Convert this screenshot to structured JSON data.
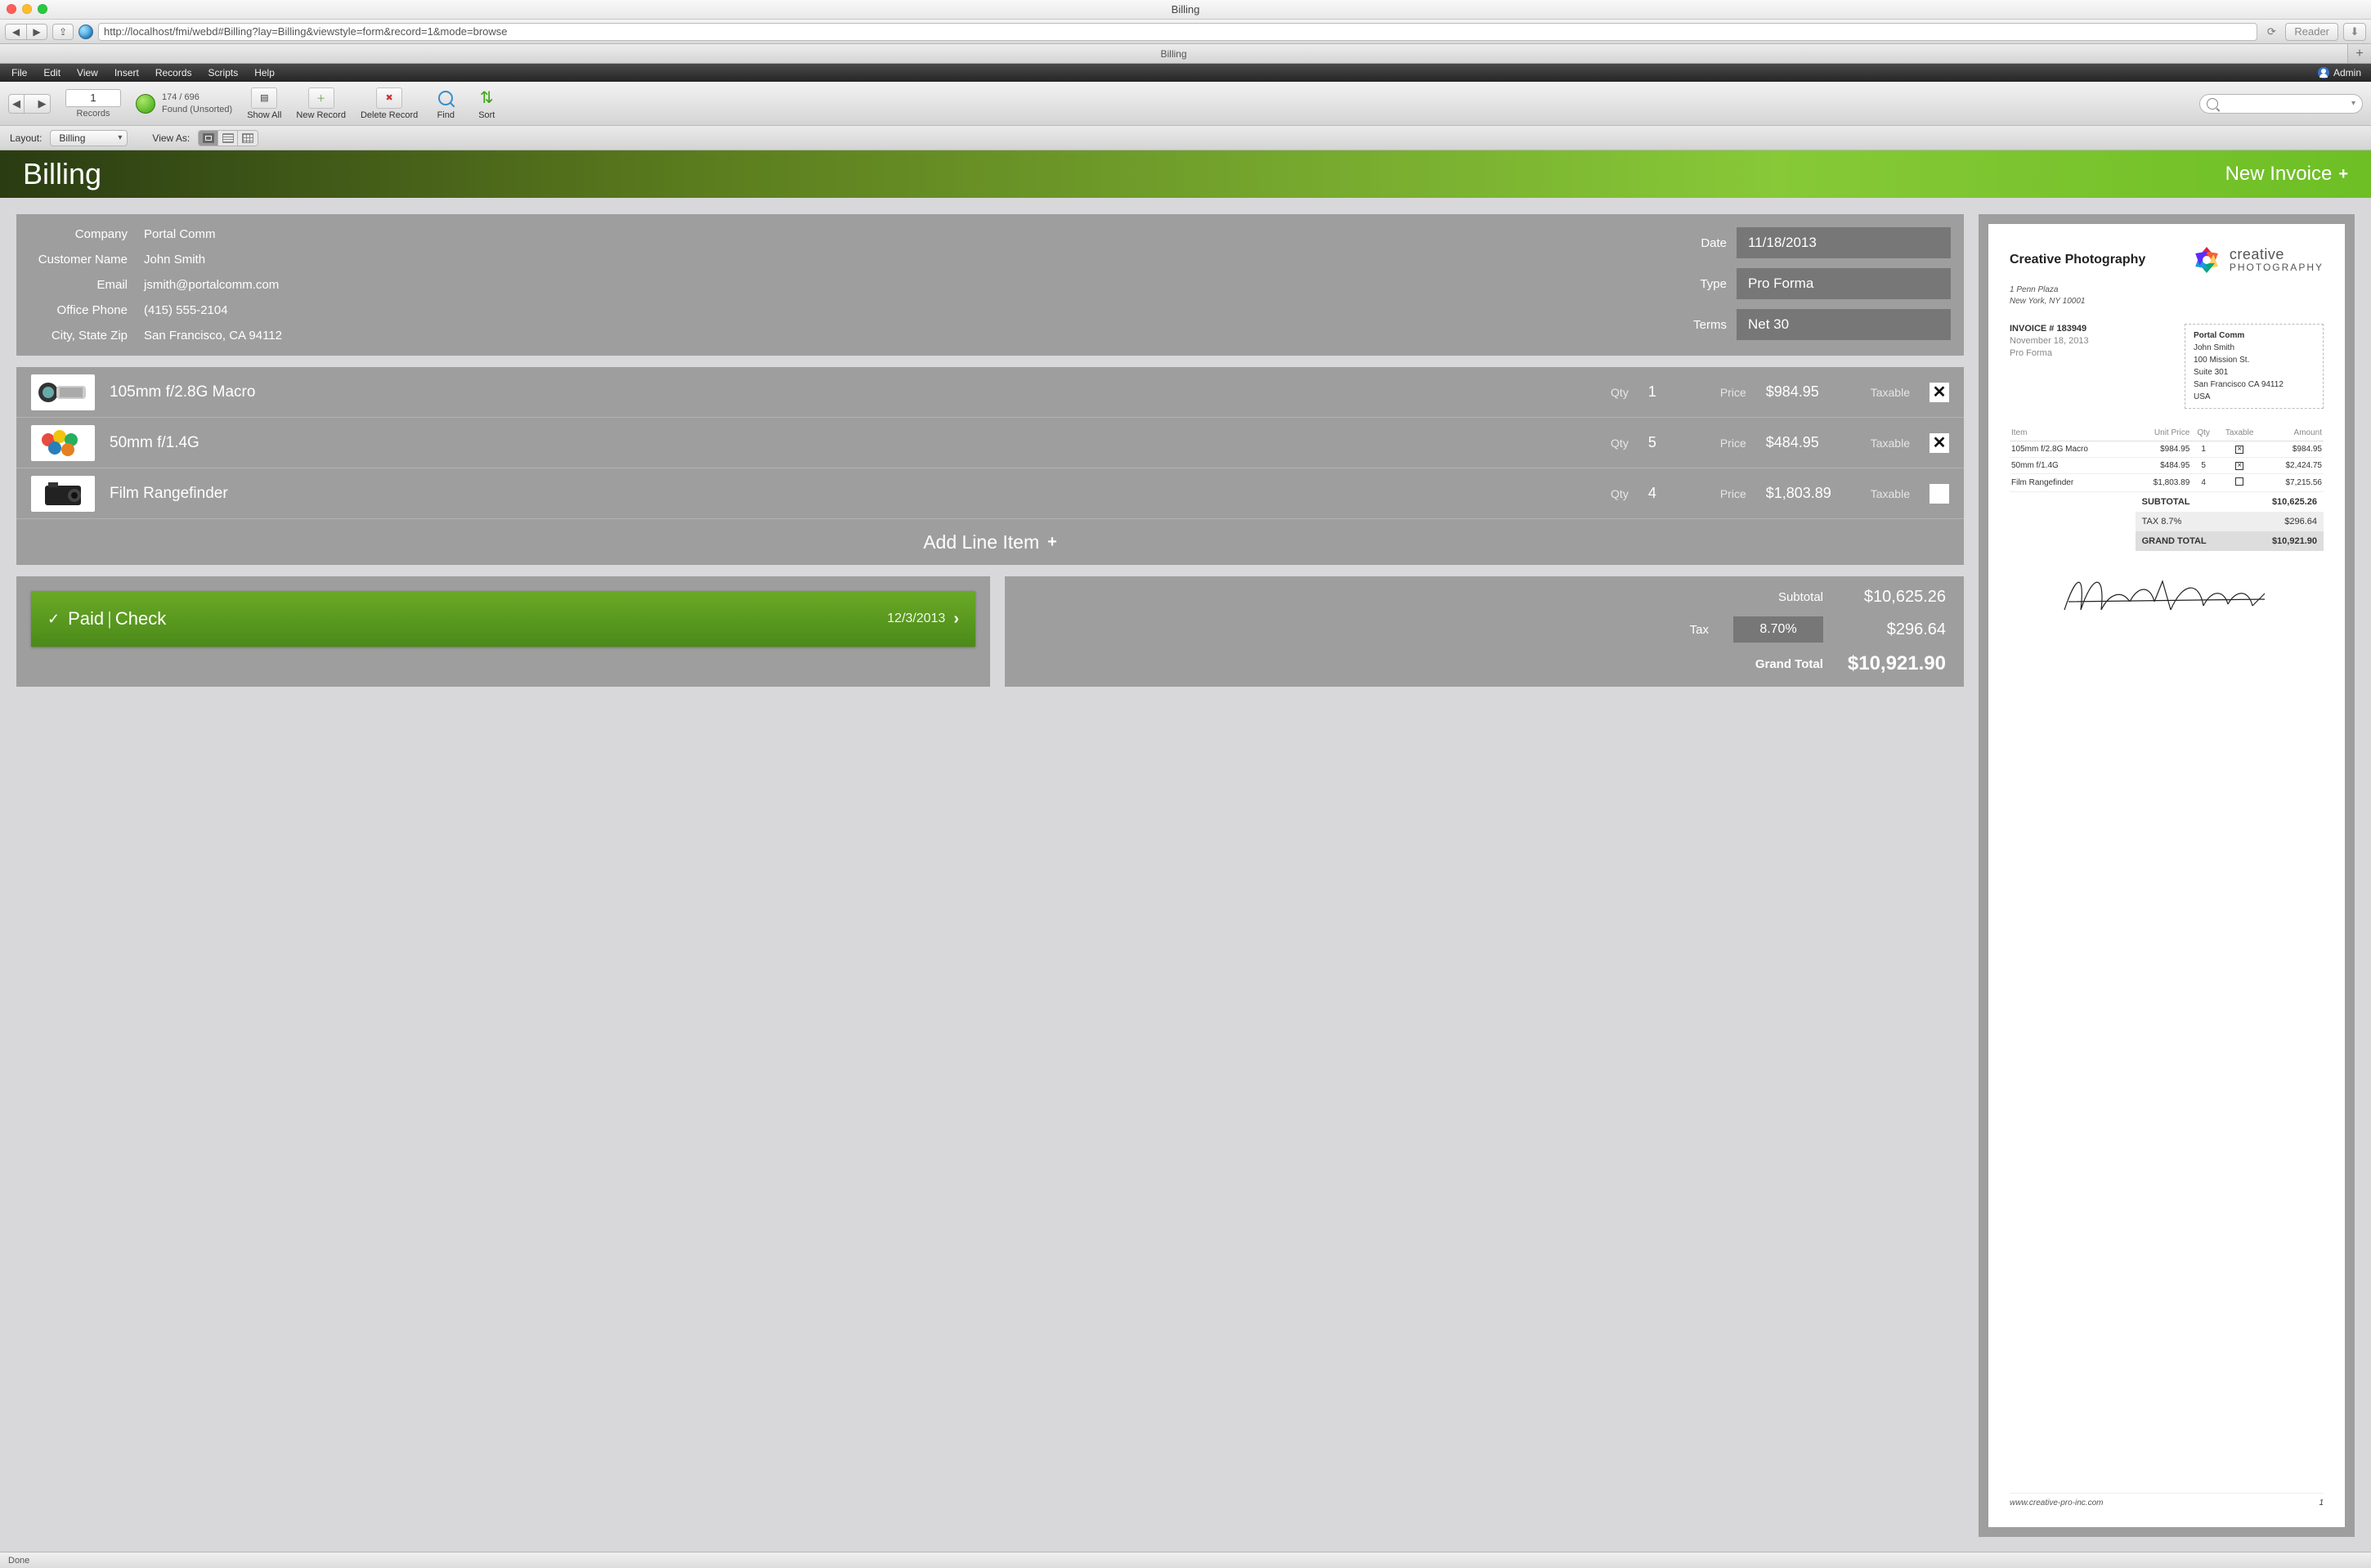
{
  "window": {
    "title": "Billing"
  },
  "browser": {
    "url": "http://localhost/fmi/webd#Billing?lay=Billing&viewstyle=form&record=1&mode=browse",
    "reader": "Reader",
    "tab": "Billing"
  },
  "menubar": {
    "items": [
      "File",
      "Edit",
      "View",
      "Insert",
      "Records",
      "Scripts",
      "Help"
    ],
    "user": "Admin"
  },
  "fmtoolbar": {
    "current_record": "1",
    "records_sub": "Records",
    "record_count": "174 / 696",
    "found_status": "Found (Unsorted)",
    "buttons": {
      "show_all": "Show All",
      "new_record": "New Record",
      "delete_record": "Delete Record",
      "find": "Find",
      "sort": "Sort"
    }
  },
  "layoutbar": {
    "label": "Layout:",
    "value": "Billing",
    "viewas": "View As:"
  },
  "header": {
    "title": "Billing",
    "new_invoice": "New Invoice"
  },
  "customer": {
    "labels": {
      "company": "Company",
      "name": "Customer Name",
      "email": "Email",
      "phone": "Office Phone",
      "csz": "City, State Zip"
    },
    "company": "Portal Comm",
    "name": "John Smith",
    "email": "jsmith@portalcomm.com",
    "phone": "(415) 555-2104",
    "csz": "San Francisco, CA 94112"
  },
  "invoice_meta": {
    "labels": {
      "date": "Date",
      "type": "Type",
      "terms": "Terms"
    },
    "date": "11/18/2013",
    "type": "Pro Forma",
    "terms": "Net 30"
  },
  "line_labels": {
    "qty": "Qty",
    "price": "Price",
    "taxable": "Taxable"
  },
  "line_items": [
    {
      "name": "105mm f/2.8G Macro",
      "qty": "1",
      "price": "$984.95",
      "taxable": true,
      "thumb": "lens"
    },
    {
      "name": "50mm f/1.4G",
      "qty": "5",
      "price": "$484.95",
      "taxable": true,
      "thumb": "filters"
    },
    {
      "name": "Film Rangefinder",
      "qty": "4",
      "price": "$1,803.89",
      "taxable": false,
      "thumb": "camera"
    }
  ],
  "add_line": "Add Line Item",
  "paid": {
    "status": "Paid",
    "method": "Check",
    "date": "12/3/2013"
  },
  "totals": {
    "labels": {
      "subtotal": "Subtotal",
      "tax": "Tax",
      "grand": "Grand Total"
    },
    "subtotal": "$10,625.26",
    "tax_rate": "8.70%",
    "tax": "$296.64",
    "grand": "$10,921.90"
  },
  "preview": {
    "company": "Creative Photography",
    "addr1": "1 Penn Plaza",
    "addr2": "New York, NY 10001",
    "logo_l1": "creative",
    "logo_l2": "PHOTOGRAPHY",
    "invoice_no": "INVOICE # 183949",
    "invoice_date": "November 18, 2013",
    "invoice_type": "Pro Forma",
    "billto": {
      "company": "Portal Comm",
      "name": "John Smith",
      "street": "100 Mission St.",
      "suite": "Suite 301",
      "csz": "San Francisco CA 94112",
      "country": "USA"
    },
    "columns": {
      "item": "Item",
      "uprice": "Unit Price",
      "qty": "Qty",
      "taxable": "Taxable",
      "amount": "Amount"
    },
    "rows": [
      {
        "item": "105mm f/2.8G Macro",
        "uprice": "$984.95",
        "qty": "1",
        "taxable": true,
        "amount": "$984.95"
      },
      {
        "item": "50mm f/1.4G",
        "uprice": "$484.95",
        "qty": "5",
        "taxable": true,
        "amount": "$2,424.75"
      },
      {
        "item": "Film Rangefinder",
        "uprice": "$1,803.89",
        "qty": "4",
        "taxable": false,
        "amount": "$7,215.56"
      }
    ],
    "subtotal_label": "SUBTOTAL",
    "subtotal": "$10,625.26",
    "tax_label": "TAX  8.7%",
    "tax": "$296.64",
    "grand_label": "GRAND TOTAL",
    "grand": "$10,921.90",
    "footer": "www.creative-pro-inc.com",
    "page": "1"
  },
  "statusbar": {
    "text": "Done"
  }
}
